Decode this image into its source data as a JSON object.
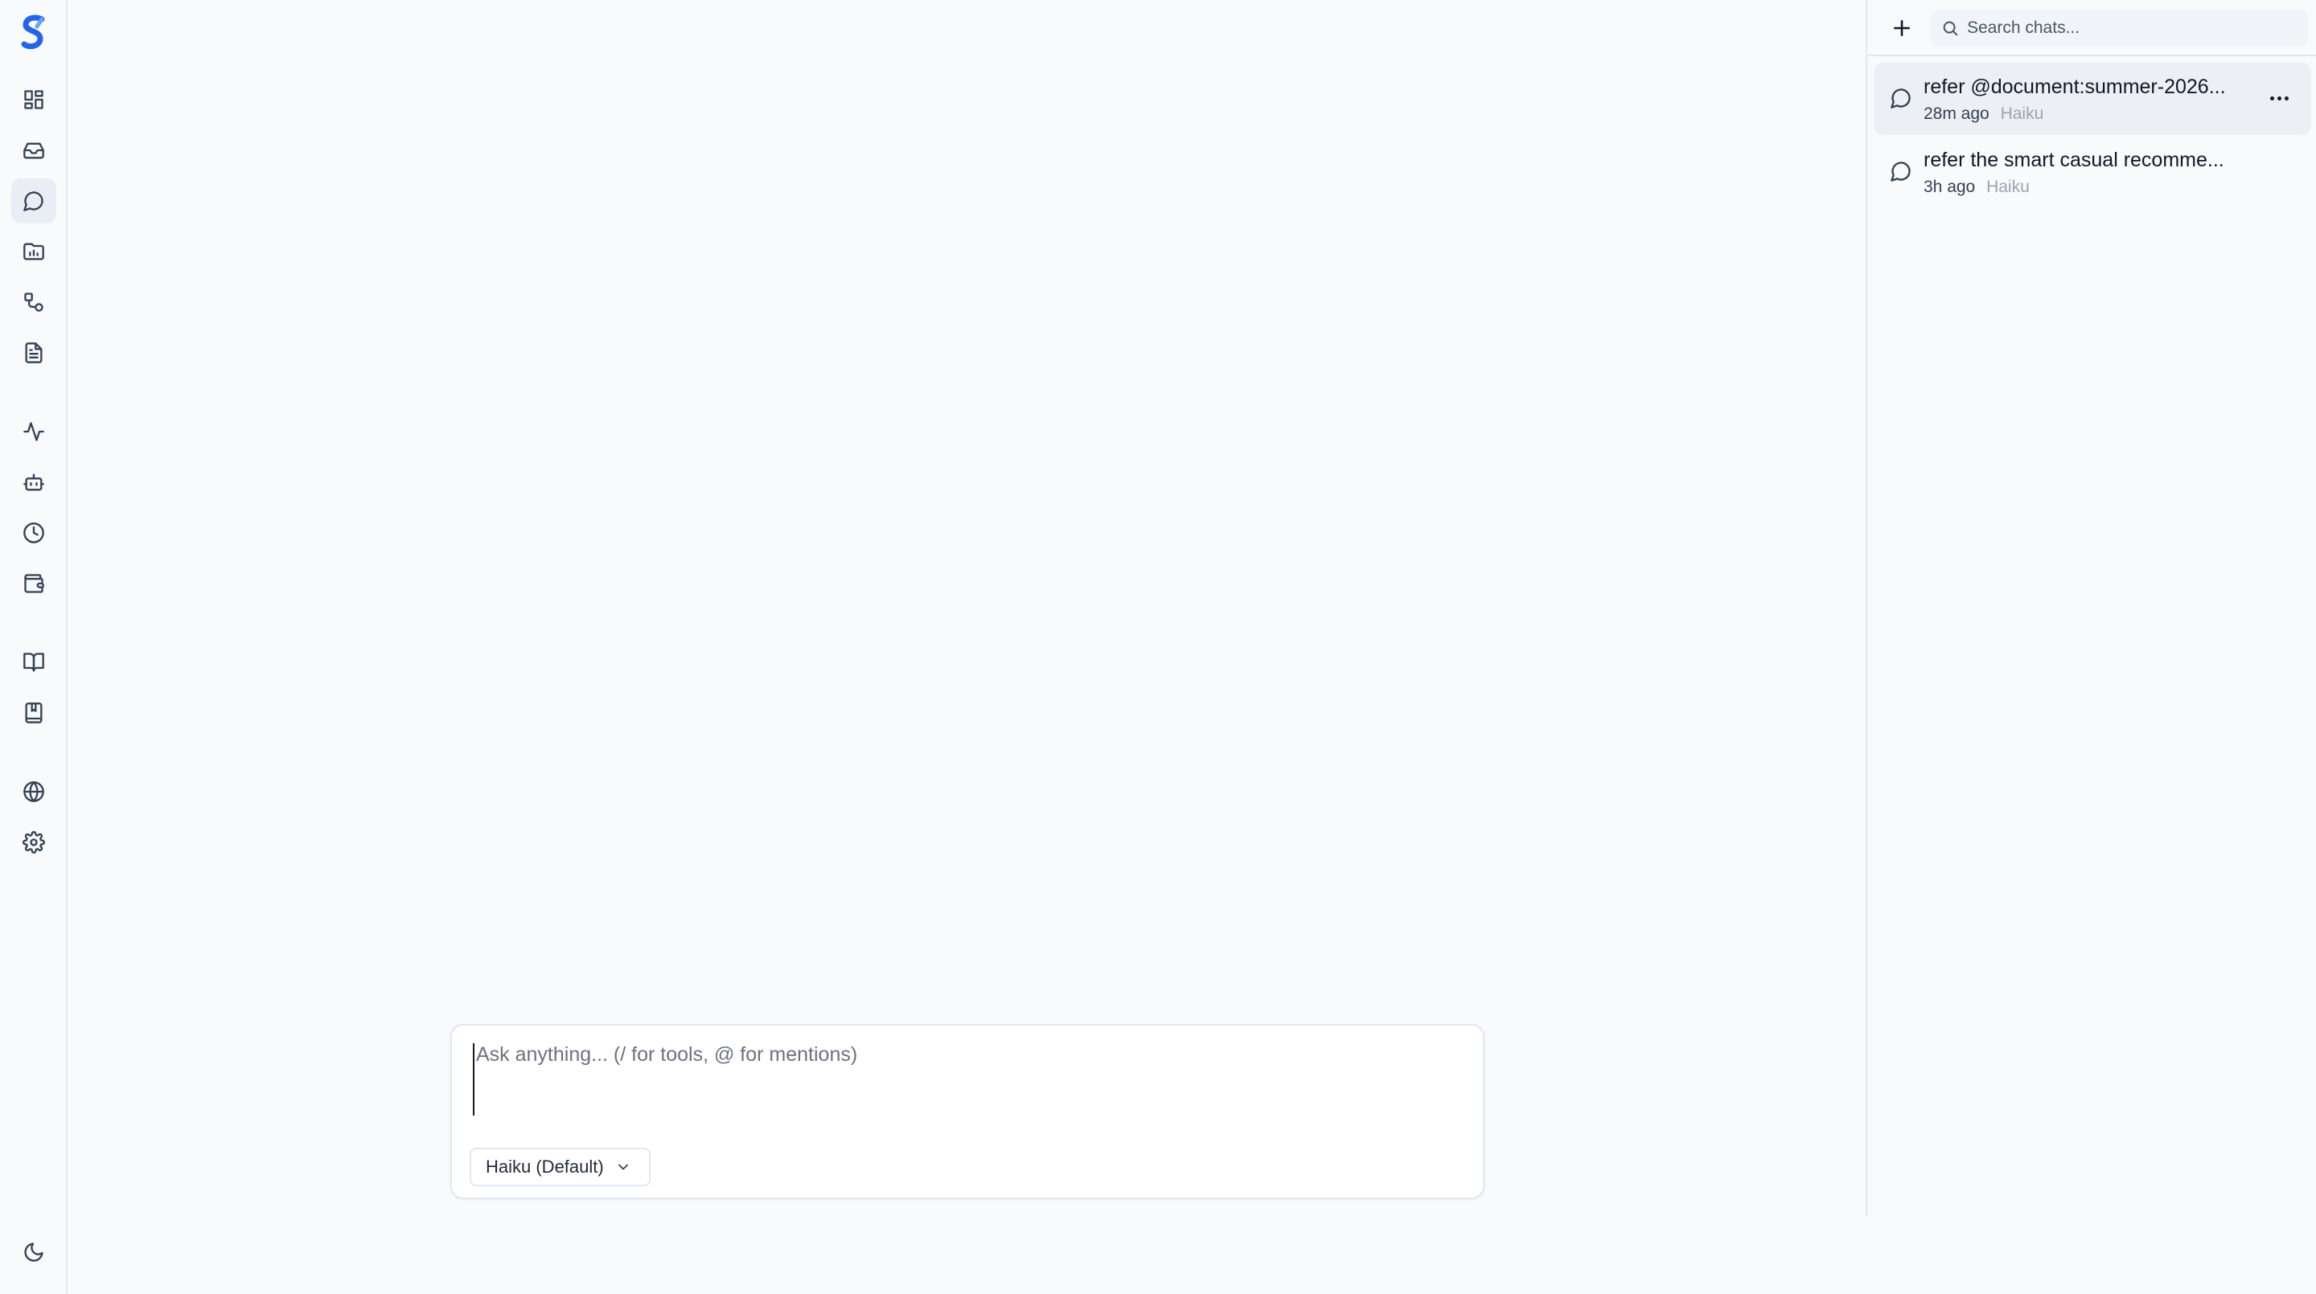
{
  "rail": {
    "logo": "brand-s-logo",
    "items": [
      {
        "icon": "dashboard-icon",
        "active": false
      },
      {
        "icon": "inbox-icon",
        "active": false
      },
      {
        "icon": "chat-icon",
        "active": true
      },
      {
        "icon": "folder-chart-icon",
        "active": false
      },
      {
        "icon": "workflow-icon",
        "active": false
      },
      {
        "icon": "document-icon",
        "active": false
      },
      {
        "icon": "activity-icon",
        "active": false
      },
      {
        "icon": "bot-icon",
        "active": false
      },
      {
        "icon": "clock-icon",
        "active": false
      },
      {
        "icon": "wallet-icon",
        "active": false
      },
      {
        "icon": "book-open-icon",
        "active": false
      },
      {
        "icon": "notebook-icon",
        "active": false
      },
      {
        "icon": "globe-icon",
        "active": false
      },
      {
        "icon": "gear-icon",
        "active": false
      },
      {
        "icon": "moon-icon",
        "active": false
      }
    ]
  },
  "composer": {
    "placeholder": "Ask anything... (/ for tools, @ for mentions)",
    "value": "",
    "model_select": "Haiku (Default)"
  },
  "panel": {
    "search_placeholder": "Search chats...",
    "chats": [
      {
        "title": "refer @document:summer-2026...",
        "time": "28m ago",
        "model": "Haiku",
        "selected": true
      },
      {
        "title": "refer the smart casual recomme...",
        "time": "3h ago",
        "model": "Haiku",
        "selected": false
      }
    ]
  },
  "colors": {
    "background": "#f8fafc",
    "brand": "#2563eb",
    "border": "#e5e7eb",
    "selected_row": "#eceff4"
  }
}
